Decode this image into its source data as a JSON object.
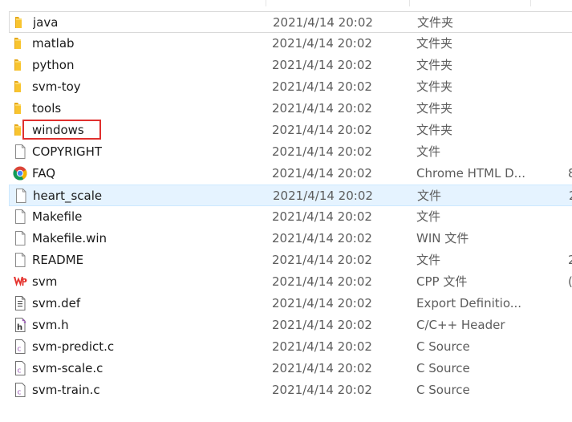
{
  "files": [
    {
      "name": "java",
      "date": "2021/4/14 20:02",
      "type": "文件夹",
      "size": "",
      "icon": "folder-icon"
    },
    {
      "name": "matlab",
      "date": "2021/4/14 20:02",
      "type": "文件夹",
      "size": "",
      "icon": "folder-icon"
    },
    {
      "name": "python",
      "date": "2021/4/14 20:02",
      "type": "文件夹",
      "size": "",
      "icon": "folder-icon"
    },
    {
      "name": "svm-toy",
      "date": "2021/4/14 20:02",
      "type": "文件夹",
      "size": "",
      "icon": "folder-icon"
    },
    {
      "name": "tools",
      "date": "2021/4/14 20:02",
      "type": "文件夹",
      "size": "",
      "icon": "folder-icon"
    },
    {
      "name": "windows",
      "date": "2021/4/14 20:02",
      "type": "文件夹",
      "size": "",
      "icon": "folder-icon"
    },
    {
      "name": "COPYRIGHT",
      "date": "2021/4/14 20:02",
      "type": "文件",
      "size": "",
      "icon": "file-icon"
    },
    {
      "name": "FAQ",
      "date": "2021/4/14 20:02",
      "type": "Chrome HTML D...",
      "size": "8",
      "icon": "chrome-icon"
    },
    {
      "name": "heart_scale",
      "date": "2021/4/14 20:02",
      "type": "文件",
      "size": "2",
      "icon": "file-icon"
    },
    {
      "name": "Makefile",
      "date": "2021/4/14 20:02",
      "type": "文件",
      "size": "",
      "icon": "file-icon"
    },
    {
      "name": "Makefile.win",
      "date": "2021/4/14 20:02",
      "type": "WIN 文件",
      "size": "",
      "icon": "file-icon"
    },
    {
      "name": "README",
      "date": "2021/4/14 20:02",
      "type": "文件",
      "size": "2",
      "icon": "file-icon"
    },
    {
      "name": "svm",
      "date": "2021/4/14 20:02",
      "type": "CPP 文件",
      "size": "(",
      "icon": "wps-icon"
    },
    {
      "name": "svm.def",
      "date": "2021/4/14 20:02",
      "type": "Export Definitio...",
      "size": "",
      "icon": "def-file-icon"
    },
    {
      "name": "svm.h",
      "date": "2021/4/14 20:02",
      "type": "C/C++ Header",
      "size": "",
      "icon": "header-file-icon"
    },
    {
      "name": "svm-predict.c",
      "date": "2021/4/14 20:02",
      "type": "C Source",
      "size": "",
      "icon": "c-source-icon"
    },
    {
      "name": "svm-scale.c",
      "date": "2021/4/14 20:02",
      "type": "C Source",
      "size": "",
      "icon": "c-source-icon"
    },
    {
      "name": "svm-train.c",
      "date": "2021/4/14 20:02",
      "type": "C Source",
      "size": "",
      "icon": "c-source-icon"
    }
  ],
  "selected_name": "heart_scale",
  "outlined_name": "java",
  "highlighted_name": "windows",
  "colors": {
    "folder": "#f8c42f",
    "selection": "#e5f3ff",
    "highlight_box": "#e0302e",
    "wps_red": "#e5322d"
  }
}
